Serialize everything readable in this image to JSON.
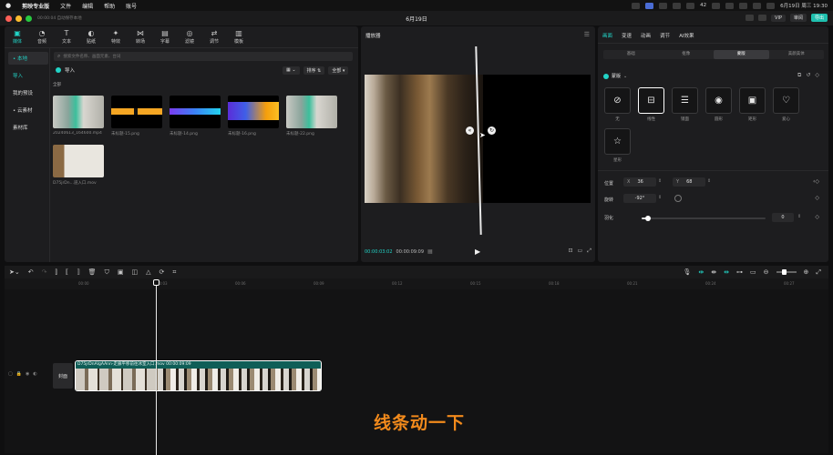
{
  "menubar": {
    "app": "剪映专业版",
    "items": [
      "文件",
      "编辑",
      "帮助",
      "账号"
    ],
    "clock": "6月19日 周三 19:30",
    "battery": "42"
  },
  "titlebar": {
    "left_text": "00:00:04 自动保存本地",
    "title": "6月19日",
    "buttons": [
      "VIP",
      "审阅",
      "导出"
    ]
  },
  "media_panel": {
    "toolbar": [
      {
        "label": "媒体",
        "icon": "media-icon"
      },
      {
        "label": "音频",
        "icon": "audio-icon"
      },
      {
        "label": "文本",
        "icon": "text-icon"
      },
      {
        "label": "贴纸",
        "icon": "sticker-icon"
      },
      {
        "label": "特效",
        "icon": "effects-icon"
      },
      {
        "label": "转场",
        "icon": "transition-icon"
      },
      {
        "label": "字幕",
        "icon": "caption-icon"
      },
      {
        "label": "滤镜",
        "icon": "filter-icon"
      },
      {
        "label": "调节",
        "icon": "adjust-icon"
      },
      {
        "label": "模板",
        "icon": "template-icon"
      }
    ],
    "sidebar": [
      "• 本地",
      "导入",
      "我的预设",
      "• 云素材",
      "素材库"
    ],
    "search_placeholder": "搜索文件名称、画面元素、台词",
    "import_label": "导入",
    "sort_label": "排序",
    "all_label": "全部",
    "section_label": "全部",
    "items": [
      {
        "label": "20240613_164600.mp4"
      },
      {
        "label": "未标题-15.png"
      },
      {
        "label": "未标题-14.png"
      },
      {
        "label": "未标题-16.png"
      },
      {
        "label": "未标题-22.png"
      },
      {
        "label": "D75jrDn...道入口.mov"
      }
    ]
  },
  "player": {
    "title": "播放器",
    "current": "00:00:03:02",
    "total": "00:00:09:09"
  },
  "inspector": {
    "tabs": [
      "画面",
      "变速",
      "动画",
      "调节",
      "AI效果"
    ],
    "subtabs": [
      "基础",
      "抠像",
      "蒙版",
      "美颜美体"
    ],
    "mask_title": "蒙版",
    "masks": [
      "无",
      "线性",
      "镜面",
      "圆形",
      "矩形",
      "爱心",
      "星形"
    ],
    "position_label": "位置",
    "x_label": "X",
    "x_value": "36",
    "y_label": "Y",
    "y_value": "68",
    "rotate_label": "旋转",
    "rotate_value": "-92°",
    "feather_label": "羽化",
    "feather_value": "0",
    "feather_level": 0.05
  },
  "timeline": {
    "ruler": [
      "00:00",
      "00:03",
      "00:06",
      "00:09",
      "00:12",
      "00:15",
      "00:18",
      "00:21",
      "00:24",
      "00:27"
    ],
    "cover_label": "封面",
    "clip_title": "D75jrDnAIgAAnn-走廊平移前往冰室入口.mov  00:00:09:09",
    "subtitle": "线条动一下"
  }
}
